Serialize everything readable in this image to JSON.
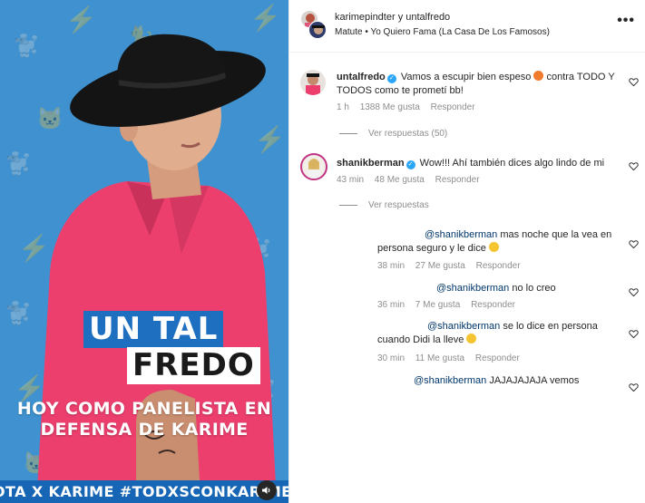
{
  "media": {
    "title_line1": "UN TAL",
    "title_line2": "FREDO",
    "subtitle_line1": "HOY COMO PANELISTA EN",
    "subtitle_line2": "DEFENSA DE KARIME",
    "ticker": "OTA X KARIME #TODXSCONKARIME",
    "colors": {
      "background": "#3f92cf",
      "title_blue": "#1f6fc0",
      "ticker": "#1666b5",
      "shirt": "#ec3f6e",
      "hat": "#141414"
    }
  },
  "post": {
    "authors": "karimepindter y untalfredo",
    "audio": "Matute • Yo Quiero Fama (La Casa De Los Famosos)",
    "more_icon": "more-horizontal-icon"
  },
  "comments": [
    {
      "user": "untalfredo",
      "text_before_emoji": "Vamos a escupir bien espeso",
      "emoji": "fire-emoji",
      "text_after_emoji": "contra TODO Y TODOS como te prometí bb!",
      "time": "1 h",
      "likes": "1388 Me gusta",
      "reply": "Responder",
      "view_replies": "Ver respuestas (50)"
    },
    {
      "user": "shanikberman",
      "text": "Wow!!! Ahí también dices algo lindo de mi",
      "time": "43 min",
      "likes": "48 Me gusta",
      "reply": "Responder",
      "view_replies": "Ver respuestas"
    }
  ],
  "replies": [
    {
      "mention": "@shanikberman",
      "text": "mas noche que la vea en persona seguro y le dice",
      "emoji": "laughing-emoji",
      "time": "38 min",
      "likes": "27 Me gusta",
      "reply": "Responder"
    },
    {
      "mention": "@shanikberman",
      "text": "no lo creo",
      "time": "36 min",
      "likes": "7 Me gusta",
      "reply": "Responder"
    },
    {
      "mention": "@shanikberman",
      "text": "se lo dice en persona cuando Didi la lleve",
      "emoji": "laughing-emoji",
      "time": "30 min",
      "likes": "11 Me gusta",
      "reply": "Responder"
    },
    {
      "mention": "@shanikberman",
      "text": "JAJAJAJAJA vemos"
    }
  ]
}
